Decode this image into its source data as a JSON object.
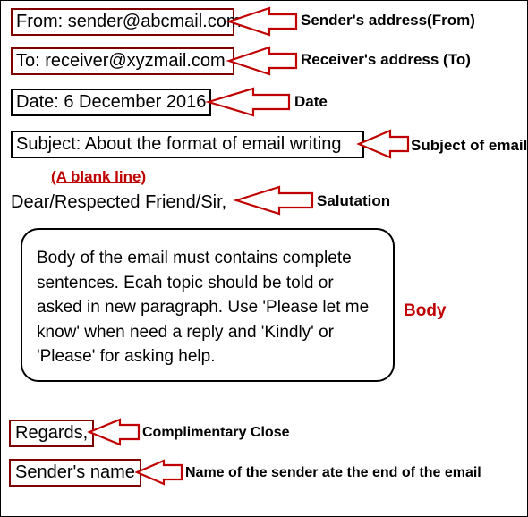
{
  "fields": {
    "from": "From: sender@abcmail.com",
    "to": "To: receiver@xyzmail.com",
    "date": "Date: 6 December 2016",
    "subject": "Subject: About the format of email writing"
  },
  "blank_line": "(A blank line)",
  "salutation": "Dear/Respected Friend/Sir,",
  "body": "Body of the email must contains complete sentences. Ecah topic should be told or asked in new paragraph. Use 'Please let me know' when need a reply and 'Kindly' or 'Please' for asking help.",
  "regards": "Regards,",
  "sender_name": "Sender's name",
  "captions": {
    "from": "Sender's address(From)",
    "to": "Receiver's address (To)",
    "date": "Date",
    "subject": "Subject of email",
    "salutation": "Salutation",
    "body": "Body",
    "close": "Complimentary Close",
    "sender_name": "Name of the sender ate the end of the email"
  }
}
